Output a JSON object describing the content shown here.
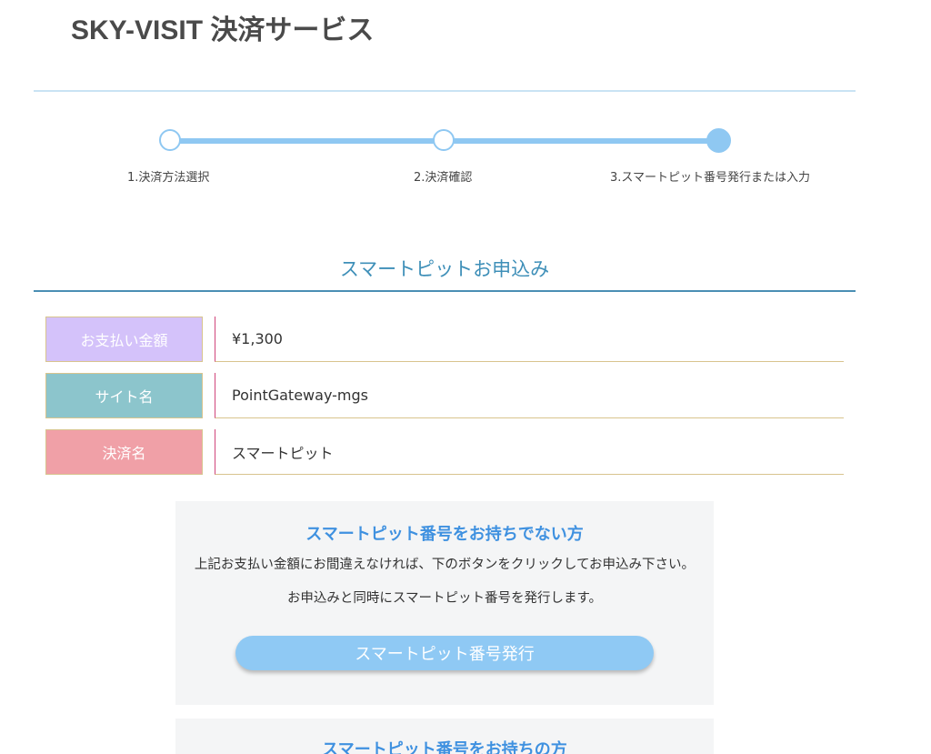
{
  "header": {
    "title": "SKY-VISIT 決済サービス"
  },
  "steps": [
    {
      "label": "1.決済方法選択",
      "state": "done"
    },
    {
      "label": "2.決済確認",
      "state": "done"
    },
    {
      "label": "3.スマートピット番号発行または入力",
      "state": "current"
    }
  ],
  "section": {
    "title": "スマートピットお申込み"
  },
  "info_rows": [
    {
      "label": "お支払い金額",
      "value": "¥1,300",
      "color": "#d4c2fa"
    },
    {
      "label": "サイト名",
      "value": "PointGateway-mgs",
      "color": "#8cc5cc"
    },
    {
      "label": "決済名",
      "value": "スマートピット",
      "color": "#f0a0a7"
    }
  ],
  "no_number_panel": {
    "title": "スマートピット番号をお持ちでない方",
    "text1": "上記お支払い金額にお間違えなければ、下のボタンをクリックしてお申込み下さい。",
    "text2": "お申込みと同時にスマートピット番号を発行します。",
    "button_label": "スマートピット番号発行"
  },
  "has_number_panel": {
    "title": "スマートピット番号をお持ちの方"
  },
  "colors": {
    "accent": "#8fc8f2",
    "section_title": "#3e8fb8",
    "panel_title": "#3f91e0"
  }
}
